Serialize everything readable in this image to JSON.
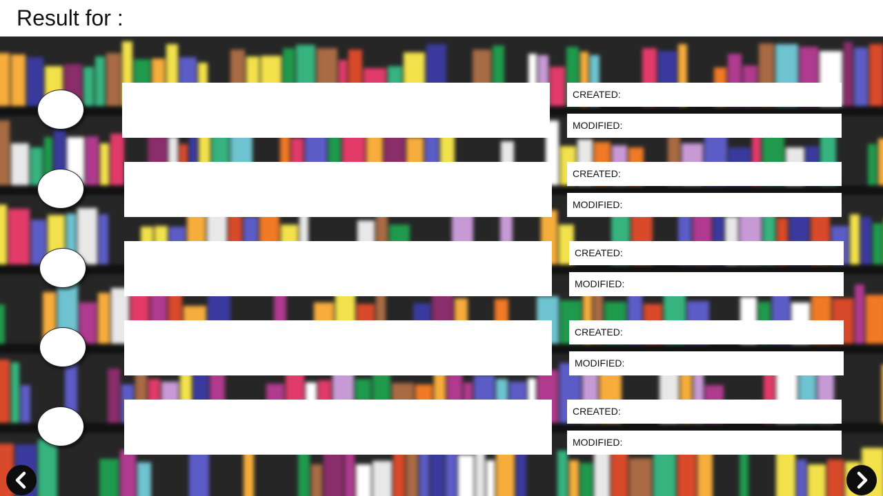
{
  "header": {
    "title": "Result for :"
  },
  "results": [
    {
      "created_label": "CREATED:",
      "modified_label": "MODIFIED:"
    },
    {
      "created_label": "CREATED:",
      "modified_label": "MODIFIED:"
    },
    {
      "created_label": "CREATED:",
      "modified_label": "MODIFIED:"
    },
    {
      "created_label": "CREATED:",
      "modified_label": "MODIFIED:"
    },
    {
      "created_label": "CREATED:",
      "modified_label": "MODIFIED:"
    }
  ],
  "navigation": {
    "prev_icon": "chevron-left-icon",
    "next_icon": "chevron-right-icon"
  },
  "colors": {
    "header_bg": "#ffffff",
    "shelf_bg": "#262626",
    "nav_button": "#0d0d0d"
  }
}
